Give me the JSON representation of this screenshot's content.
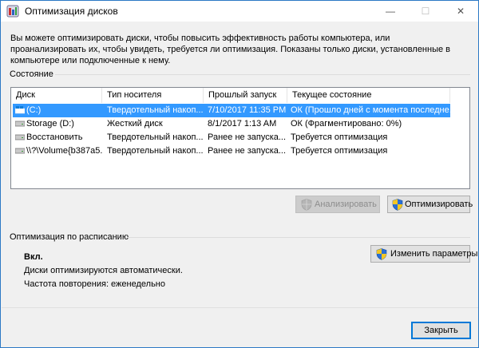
{
  "window": {
    "title": "Оптимизация дисков",
    "min_glyph": "—",
    "max_glyph": "☐",
    "close_glyph": "✕"
  },
  "intro_text": "Вы можете оптимизировать диски, чтобы повысить эффективность работы  компьютера, или проанализировать их, чтобы увидеть, требуется ли оптимизация. Показаны только диски, установленные в компьютере или подключенные к нему.",
  "status_group": {
    "label": "Состояние"
  },
  "table": {
    "columns": [
      "Диск",
      "Тип носителя",
      "Прошлый запуск",
      "Текущее состояние"
    ],
    "rows": [
      {
        "icon": "ssd-drive-icon",
        "disk": "(C:)",
        "media": "Твердотельный накоп...",
        "last_run": "7/10/2017 11:35 PM",
        "status": "ОК (Прошло дней с момента последне...",
        "selected": true
      },
      {
        "icon": "hdd-drive-icon",
        "disk": "Storage (D:)",
        "media": "Жесткий диск",
        "last_run": "8/1/2017 1:13 AM",
        "status": "ОК (Фрагментировано: 0%)",
        "selected": false
      },
      {
        "icon": "hdd-drive-icon",
        "disk": "Восстановить",
        "media": "Твердотельный накоп...",
        "last_run": "Ранее не запуска...",
        "status": "Требуется оптимизация",
        "selected": false
      },
      {
        "icon": "hdd-drive-icon",
        "disk": "\\\\?\\Volume{b387a5...",
        "media": "Твердотельный накоп...",
        "last_run": "Ранее не запуска...",
        "status": "Требуется оптимизация",
        "selected": false
      }
    ]
  },
  "buttons": {
    "analyze": "Анализировать",
    "optimize": "Оптимизировать",
    "change_settings": "Изменить параметры",
    "close": "Закрыть"
  },
  "schedule": {
    "label": "Оптимизация по расписанию",
    "state": "Вкл.",
    "auto_text": "Диски оптимизируются автоматически.",
    "frequency_text": "Частота повторения: еженедельно"
  },
  "colors": {
    "selection": "#3399ff",
    "window_border": "#2b78c5",
    "default_button_border": "#0078d7"
  }
}
